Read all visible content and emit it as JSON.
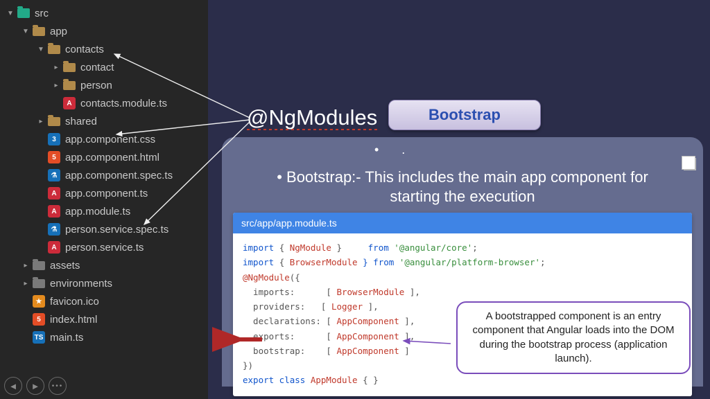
{
  "tree": [
    {
      "depth": 0,
      "arrow": "down",
      "icon": "folder-teal",
      "label": "src"
    },
    {
      "depth": 1,
      "arrow": "down",
      "icon": "folder-tan",
      "label": "app"
    },
    {
      "depth": 2,
      "arrow": "down",
      "icon": "folder-tan",
      "label": "contacts"
    },
    {
      "depth": 3,
      "arrow": "right",
      "icon": "folder-tan",
      "label": "contact"
    },
    {
      "depth": 3,
      "arrow": "right",
      "icon": "folder-tan",
      "label": "person"
    },
    {
      "depth": 3,
      "arrow": "none",
      "icon": "ang",
      "label": "contacts.module.ts"
    },
    {
      "depth": 2,
      "arrow": "right",
      "icon": "folder-tan",
      "label": "shared"
    },
    {
      "depth": 2,
      "arrow": "none",
      "icon": "css",
      "label": "app.component.css"
    },
    {
      "depth": 2,
      "arrow": "none",
      "icon": "html",
      "label": "app.component.html"
    },
    {
      "depth": 2,
      "arrow": "none",
      "icon": "spec",
      "label": "app.component.spec.ts"
    },
    {
      "depth": 2,
      "arrow": "none",
      "icon": "ang",
      "label": "app.component.ts"
    },
    {
      "depth": 2,
      "arrow": "none",
      "icon": "ang",
      "label": "app.module.ts"
    },
    {
      "depth": 2,
      "arrow": "none",
      "icon": "spec",
      "label": "person.service.spec.ts"
    },
    {
      "depth": 2,
      "arrow": "none",
      "icon": "ang",
      "label": "person.service.ts"
    },
    {
      "depth": 1,
      "arrow": "right",
      "icon": "folder-grey",
      "label": "assets"
    },
    {
      "depth": 1,
      "arrow": "right",
      "icon": "folder-grey",
      "label": "environments"
    },
    {
      "depth": 1,
      "arrow": "none",
      "icon": "star",
      "label": "favicon.ico"
    },
    {
      "depth": 1,
      "arrow": "none",
      "icon": "html",
      "label": "index.html"
    },
    {
      "depth": 1,
      "arrow": "none",
      "icon": "ts",
      "label": "main.ts"
    }
  ],
  "heading": "@NgModules",
  "bootstrap_btn": "Bootstrap",
  "bullet": "Bootstrap:- This includes the main app component for starting the execution",
  "code": {
    "file": "src/app/app.module.ts",
    "lines": {
      "l1a": "import",
      "l1b": "{ ",
      "l1c": "NgModule",
      "l1d": " }",
      "l1e": "     from ",
      "l1f": "'@angular/core'",
      "l1g": ";",
      "l2a": "import",
      "l2b": "{ ",
      "l2c": "BrowserModule",
      "l2d": " } from ",
      "l2e": "'@angular/platform-browser'",
      "l2f": ";",
      "l3": "@NgModule",
      "l3b": "({",
      "l4a": "  imports:      [ ",
      "l4b": "BrowserModule",
      "l4c": " ],",
      "l5a": "  providers:   [ ",
      "l5b": "Logger",
      "l5c": " ],",
      "l6a": "  declarations: [ ",
      "l6b": "AppComponent",
      "l6c": " ],",
      "l7a": "  exports:      [ ",
      "l7b": "AppComponent",
      "l7c": " ],",
      "l8a": "  bootstrap:    [ ",
      "l8b": "AppComponent",
      "l8c": " ]",
      "l9": "})",
      "l10a": "export class ",
      "l10b": "AppModule",
      "l10c": " { }"
    }
  },
  "callout": "A bootstrapped component is an entry component that Angular loads into the DOM during the bootstrap process (application launch).",
  "icon_letters": {
    "ang": "A",
    "css": "3",
    "html": "5",
    "spec": "⚗",
    "ts": "TS",
    "star": "★"
  }
}
